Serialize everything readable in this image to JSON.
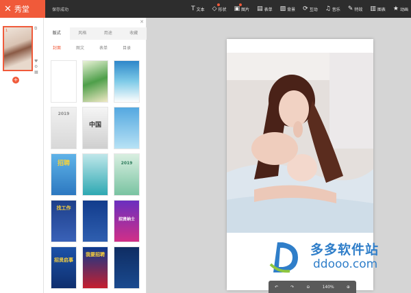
{
  "app": {
    "logo_text": "秀堂",
    "logo_mark": "✕",
    "save_status": "保存成功"
  },
  "toolbar": [
    {
      "label": "文本",
      "icon": "text-icon"
    },
    {
      "label": "形状",
      "icon": "shape-icon",
      "badge": true
    },
    {
      "label": "图片",
      "icon": "image-icon",
      "badge": true
    },
    {
      "label": "表单",
      "icon": "form-icon"
    },
    {
      "label": "背景",
      "icon": "background-icon"
    },
    {
      "label": "互动",
      "icon": "interaction-icon"
    },
    {
      "label": "音乐",
      "icon": "music-icon"
    },
    {
      "label": "特效",
      "icon": "effects-icon"
    },
    {
      "label": "图表",
      "icon": "chart-icon"
    },
    {
      "label": "动画",
      "icon": "animation-icon"
    }
  ],
  "pages": {
    "current_page": "1",
    "add_label": "+"
  },
  "panel": {
    "tabs": [
      "版式",
      "风格",
      "用途",
      "收藏"
    ],
    "subtabs": [
      "封面",
      "图文",
      "表单",
      "目录"
    ],
    "cards": [
      "",
      "",
      "",
      "2019",
      "中国",
      "",
      "招聘",
      "",
      "2019",
      "找工作",
      "",
      "招贤纳士",
      "招贤启事",
      "我要招聘",
      ""
    ]
  },
  "zoom": {
    "level": "140%"
  },
  "watermark": {
    "title": "多多软件站",
    "url": "ddooo.com"
  },
  "colors": {
    "accent": "#f05a3a",
    "topbar": "#2d2d2d",
    "canvas_bg": "#d5d5d5"
  }
}
